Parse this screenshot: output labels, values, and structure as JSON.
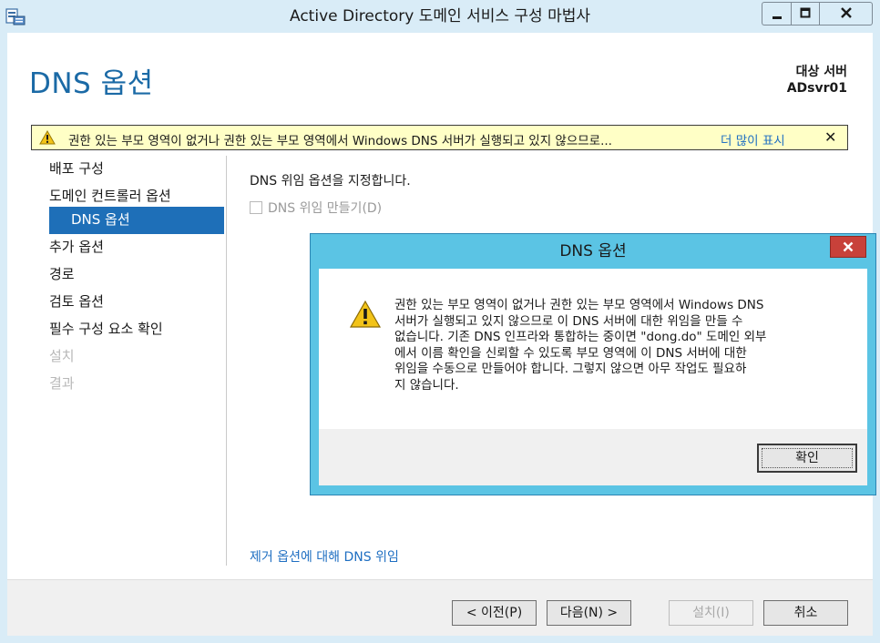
{
  "window": {
    "title": "Active Directory 도메인 서비스 구성 마법사",
    "icon": "server-wizard-icon"
  },
  "page": {
    "title": "DNS 옵션",
    "target_label": "대상 서버",
    "target_value": "ADsvr01"
  },
  "warning_bar": {
    "text": "권한 있는 부모 영역이 없거나 권한 있는 부모 영역에서 Windows DNS 서버가 실행되고 있지 않으므로...",
    "more_link": "더 많이 표시",
    "close": "✕"
  },
  "nav": {
    "items": [
      {
        "label": "배포 구성",
        "state": "normal"
      },
      {
        "label": "도메인 컨트롤러 옵션",
        "state": "normal"
      },
      {
        "label": "DNS 옵션",
        "state": "active"
      },
      {
        "label": "추가 옵션",
        "state": "normal"
      },
      {
        "label": "경로",
        "state": "normal"
      },
      {
        "label": "검토 옵션",
        "state": "normal"
      },
      {
        "label": "필수 구성 요소 확인",
        "state": "normal"
      },
      {
        "label": "설치",
        "state": "disabled"
      },
      {
        "label": "결과",
        "state": "disabled"
      }
    ]
  },
  "content": {
    "description": "DNS 위임 옵션을 지정합니다.",
    "checkbox_label": "DNS 위임 만들기(D)",
    "bottom_link": "제거 옵션에 대해 DNS 위임"
  },
  "footer": {
    "prev": "< 이전(P)",
    "next": "다음(N) >",
    "install": "설치(I)",
    "cancel": "취소"
  },
  "dialog": {
    "title": "DNS 옵션",
    "message_lines": [
      "권한 있는 부모 영역이 없거나 권한 있는 부모 영역에서 Windows DNS",
      "서버가 실행되고 있지 않으므로 이 DNS 서버에 대한 위임을 만들 수",
      "없습니다. 기존 DNS 인프라와 통합하는 중이면 \"dong.do\" 도메인 외부",
      "에서 이름 확인을 신뢰할 수 있도록 부모 영역에 이 DNS 서버에 대한",
      "위임을 수동으로 만들어야 합니다. 그렇지 않으면 아무 작업도 필요하",
      "지 않습니다."
    ],
    "ok": "확인"
  },
  "colors": {
    "accent": "#1e6fb8",
    "title_blue": "#1b6aa6",
    "link": "#1f6fc2",
    "warning_bg": "#ffffc6",
    "dialog_frame": "#5bc4e4",
    "close_red": "#c8413a"
  }
}
